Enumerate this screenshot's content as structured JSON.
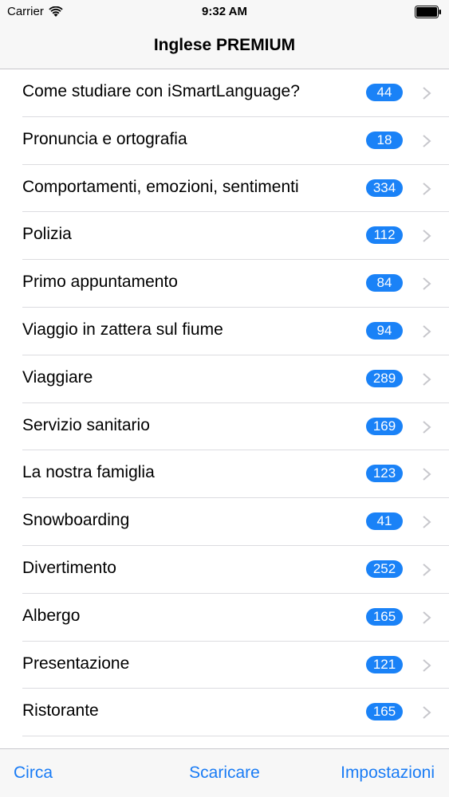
{
  "status_bar": {
    "carrier": "Carrier",
    "time": "9:32 AM",
    "wifi_icon": "wifi-icon",
    "battery_icon": "battery-icon"
  },
  "nav": {
    "title": "Inglese PREMIUM"
  },
  "list": {
    "items": [
      {
        "label": "Come studiare con iSmartLanguage?",
        "count": "44"
      },
      {
        "label": "Pronuncia e ortografia",
        "count": "18"
      },
      {
        "label": "Comportamenti, emozioni, sentimenti",
        "count": "334"
      },
      {
        "label": "Polizia",
        "count": "112"
      },
      {
        "label": "Primo appuntamento",
        "count": "84"
      },
      {
        "label": "Viaggio in zattera sul fiume",
        "count": "94"
      },
      {
        "label": "Viaggiare",
        "count": "289"
      },
      {
        "label": "Servizio sanitario",
        "count": "169"
      },
      {
        "label": "La nostra famiglia",
        "count": "123"
      },
      {
        "label": "Snowboarding",
        "count": "41"
      },
      {
        "label": "Divertimento",
        "count": "252"
      },
      {
        "label": "Albergo",
        "count": "165"
      },
      {
        "label": "Presentazione",
        "count": "121"
      },
      {
        "label": "Ristorante",
        "count": "165"
      }
    ]
  },
  "tab_bar": {
    "left": "Circa",
    "center": "Scaricare",
    "right": "Impostazioni"
  },
  "colors": {
    "accent": "#1a7cf5",
    "badge": "#1a82f7",
    "separator": "#dcdce0",
    "bar_background": "#f7f7f7"
  }
}
